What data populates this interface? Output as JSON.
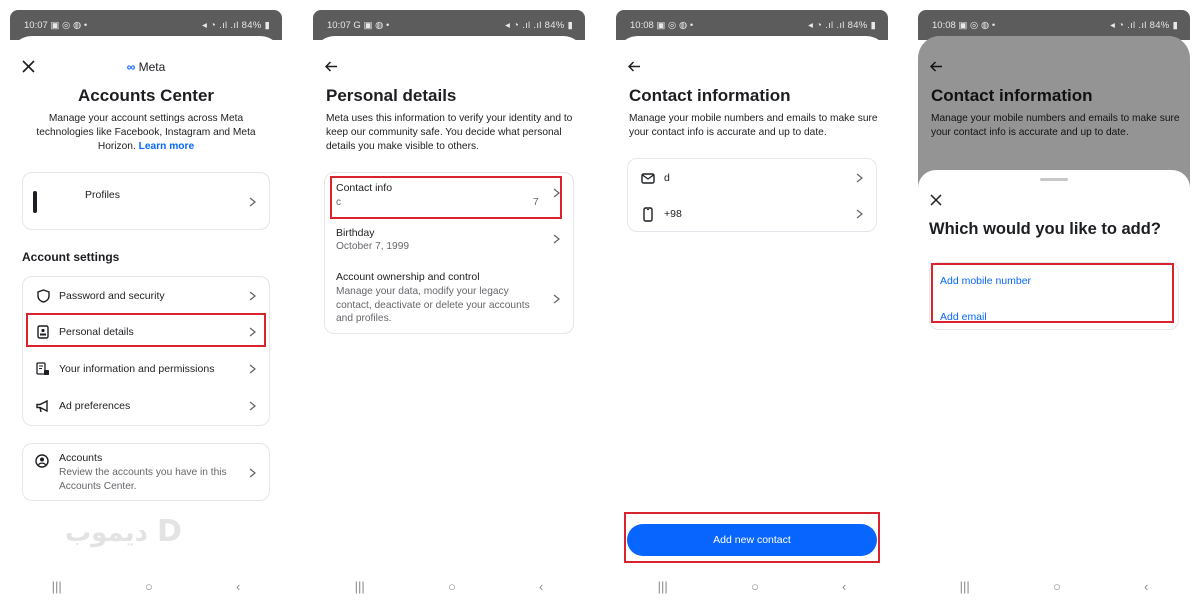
{
  "screens": [
    {
      "status": {
        "time": "10:07",
        "left_icons": "▣ ◎ ◍ •",
        "right": "◂ ◔ .ıl .ıl 84% ▮"
      },
      "logo": "Meta",
      "title": "Accounts Center",
      "description": "Manage your account settings across Meta technologies like Facebook, Instagram and Meta Horizon.",
      "learn_more": "Learn more",
      "profiles_label": "Profiles",
      "account_settings_title": "Account settings",
      "settings_items": [
        {
          "label": "Password and security",
          "icon": "shield-icon"
        },
        {
          "label": "Personal details",
          "icon": "id-card-icon"
        },
        {
          "label": "Your information and permissions",
          "icon": "info-lock-icon"
        },
        {
          "label": "Ad preferences",
          "icon": "megaphone-icon"
        }
      ],
      "accounts": {
        "title": "Accounts",
        "subtitle": "Review the accounts you have in this Accounts Center."
      },
      "watermark": "دیموب"
    },
    {
      "status": {
        "time": "10:07",
        "left_icons": "G ▣ ◍ •",
        "right": "◂ ◔ .ıl .ıl 84% ▮"
      },
      "title": "Personal details",
      "description": "Meta uses this information to verify your identity and to keep our community safe. You decide what personal details you make visible to others.",
      "items": [
        {
          "title": "Contact info",
          "value_left": "c",
          "value_right": "7"
        },
        {
          "title": "Birthday",
          "value": "October 7, 1999"
        },
        {
          "title": "Account ownership and control",
          "value": "Manage your data, modify your legacy contact, deactivate or delete your accounts and profiles."
        }
      ]
    },
    {
      "status": {
        "time": "10:08",
        "left_icons": "▣ ◎ ◍ •",
        "right": "◂ ◔ .ıl .ıl 84% ▮"
      },
      "title": "Contact information",
      "description": "Manage your mobile numbers and emails to make sure your contact info is accurate and up to date.",
      "contacts": [
        {
          "value": "d",
          "icon": "mail-icon"
        },
        {
          "value": "+98",
          "icon": "phone-icon"
        }
      ],
      "add_button": "Add new contact"
    },
    {
      "status": {
        "time": "10:08",
        "left_icons": "▣ ◎ ◍ •",
        "right": "◂ ◔ .ıl .ıl 84% ▮"
      },
      "title": "Contact information",
      "description": "Manage your mobile numbers and emails to make sure your contact info is accurate and up to date.",
      "sheet_title": "Which would you like to add?",
      "options": [
        "Add mobile number",
        "Add email"
      ]
    }
  ],
  "colors": {
    "accent": "#0866ff",
    "highlight": "#d9242e",
    "overlay": "#5c5c5c"
  }
}
